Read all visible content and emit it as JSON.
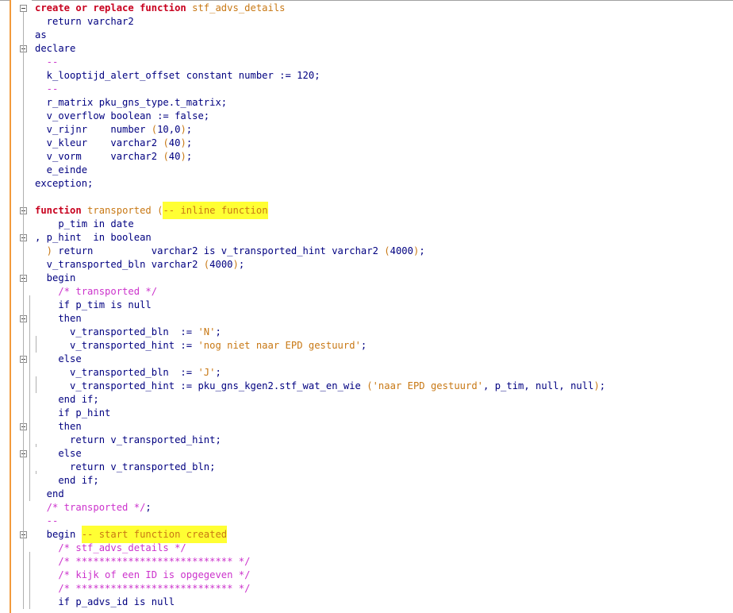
{
  "editor": {
    "lines": [
      [
        [
          "kw",
          "create or replace function "
        ],
        [
          "fn",
          "stf_advs_details"
        ]
      ],
      [
        [
          "op",
          "  return varchar2"
        ]
      ],
      [
        [
          "op",
          "as"
        ]
      ],
      [
        [
          "op",
          "declare"
        ]
      ],
      [
        [
          "cm",
          "  --"
        ]
      ],
      [
        [
          "op",
          "  k_looptijd_alert_offset constant number := 120;"
        ]
      ],
      [
        [
          "cm",
          "  --"
        ]
      ],
      [
        [
          "op",
          "  r_matrix pku_gns_type.t_matrix;"
        ]
      ],
      [
        [
          "op",
          "  v_overflow boolean := false;"
        ]
      ],
      [
        [
          "op",
          "  v_rijnr    number "
        ],
        [
          "par",
          "("
        ],
        [
          "op",
          "10,0"
        ],
        [
          "par",
          ")"
        ],
        [
          "op",
          ";"
        ]
      ],
      [
        [
          "op",
          "  v_kleur    varchar2 "
        ],
        [
          "par",
          "("
        ],
        [
          "op",
          "40"
        ],
        [
          "par",
          ")"
        ],
        [
          "op",
          ";"
        ]
      ],
      [
        [
          "op",
          "  v_vorm     varchar2 "
        ],
        [
          "par",
          "("
        ],
        [
          "op",
          "40"
        ],
        [
          "par",
          ")"
        ],
        [
          "op",
          ";"
        ]
      ],
      [
        [
          "op",
          "  e_einde"
        ]
      ],
      [
        [
          "op",
          "exception;"
        ]
      ],
      [],
      [
        [
          "kw",
          "function "
        ],
        [
          "fn",
          "transported "
        ],
        [
          "par",
          "("
        ],
        [
          "hlbox",
          "-- inline function"
        ]
      ],
      [
        [
          "op",
          "    p_tim in date"
        ]
      ],
      [
        [
          "op",
          ", p_hint  in boolean"
        ]
      ],
      [
        [
          "par",
          "  ) "
        ],
        [
          "op",
          "return          varchar2 is v_transported_hint varchar2 "
        ],
        [
          "par",
          "("
        ],
        [
          "op",
          "4000"
        ],
        [
          "par",
          ")"
        ],
        [
          "op",
          ";"
        ]
      ],
      [
        [
          "op",
          "  v_transported_bln varchar2 "
        ],
        [
          "par",
          "("
        ],
        [
          "op",
          "4000"
        ],
        [
          "par",
          ")"
        ],
        [
          "op",
          ";"
        ]
      ],
      [
        [
          "op",
          "  begin"
        ]
      ],
      [
        [
          "cm",
          "    /* transported */"
        ]
      ],
      [
        [
          "op",
          "    if p_tim is null"
        ]
      ],
      [
        [
          "op",
          "    then"
        ]
      ],
      [
        [
          "op",
          "      v_transported_bln  := "
        ],
        [
          "str",
          "'N'"
        ],
        [
          "op",
          ";"
        ]
      ],
      [
        [
          "op",
          "      v_transported_hint := "
        ],
        [
          "str",
          "'nog niet naar EPD gestuurd'"
        ],
        [
          "op",
          ";"
        ]
      ],
      [
        [
          "op",
          "    else"
        ]
      ],
      [
        [
          "op",
          "      v_transported_bln  := "
        ],
        [
          "str",
          "'J'"
        ],
        [
          "op",
          ";"
        ]
      ],
      [
        [
          "op",
          "      v_transported_hint := pku_gns_kgen2.stf_wat_en_wie "
        ],
        [
          "par",
          "("
        ],
        [
          "str",
          "'naar EPD gestuurd'"
        ],
        [
          "op",
          ", p_tim, null, null"
        ],
        [
          "par",
          ")"
        ],
        [
          "op",
          ";"
        ]
      ],
      [
        [
          "op",
          "    end if;"
        ]
      ],
      [
        [
          "op",
          "    if p_hint"
        ]
      ],
      [
        [
          "op",
          "    then"
        ]
      ],
      [
        [
          "op",
          "      return v_transported_hint;"
        ]
      ],
      [
        [
          "op",
          "    else"
        ]
      ],
      [
        [
          "op",
          "      return v_transported_bln;"
        ]
      ],
      [
        [
          "op",
          "    end if;"
        ]
      ],
      [
        [
          "op",
          "  end"
        ]
      ],
      [
        [
          "cm",
          "  /* transported */"
        ],
        [
          "op",
          ";"
        ]
      ],
      [
        [
          "cm",
          "  --"
        ]
      ],
      [
        [
          "op",
          "  begin "
        ],
        [
          "hlbox",
          "-- start function created"
        ]
      ],
      [
        [
          "cm",
          "    /* stf_advs_details */"
        ]
      ],
      [
        [
          "cm",
          "    /* *************************** */"
        ]
      ],
      [
        [
          "cm",
          "    /* kijk of een ID is opgegeven */"
        ]
      ],
      [
        [
          "cm",
          "    /* *************************** */"
        ]
      ],
      [
        [
          "op",
          "    if p_advs_id is null"
        ]
      ]
    ],
    "fold_markers": [
      0,
      3,
      15,
      17,
      20,
      23,
      26,
      31,
      33,
      39
    ]
  }
}
